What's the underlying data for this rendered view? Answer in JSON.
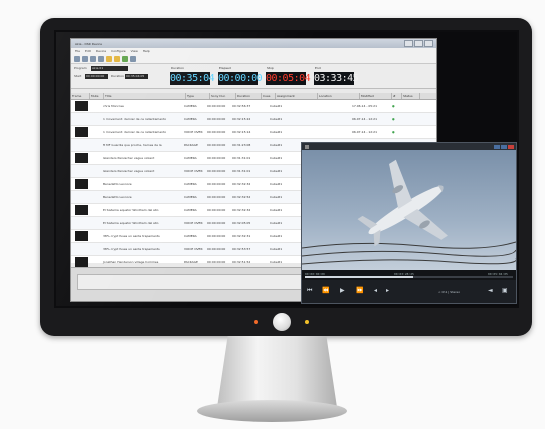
{
  "app": {
    "title": "Akia - DSR Device",
    "menu": [
      "File",
      "Edit",
      "Device",
      "Configure",
      "View",
      "Help"
    ],
    "labels": {
      "program": "Program",
      "start": "Start",
      "duration": "Duration",
      "elapsed": "Elapsed",
      "to_end": "Stop",
      "end": "End"
    },
    "fields": {
      "program_value": "Akia 01",
      "start_value": "00:00:00:00",
      "duration_value": "00:35:04:05"
    },
    "timers": {
      "duration": "00:35:04",
      "elapsed": "00:00:00",
      "remaining": "00:05:04",
      "end": "03:33:45"
    },
    "columns": [
      "Frame",
      "Mute",
      "Title",
      "Type",
      "Sony Dur.",
      "Duration",
      "Cues",
      "Assignment",
      "Location",
      "Modified",
      "#",
      "Status"
    ],
    "rows": [
      {
        "title": "chris Monrose",
        "type": "CAMERA",
        "dur": "00:00:00:00",
        "dur2": "00:32:56:37",
        "assign": "Cube#1",
        "mod": "17.06.14 - 05:21"
      },
      {
        "title": "1 movement: dernier de ce rallentamento",
        "type": "CAMERA",
        "dur": "00:00:00:00",
        "dur2": "00:32:15:22",
        "assign": "Cube#1",
        "mod": "06.07.14 - 12:21"
      },
      {
        "title": "1 movement: dernier de ce rallentamento",
        "type": "VOICE OVER",
        "dur": "00:00:00:00",
        "dur2": "00:32:15:14",
        "assign": "Cube#1",
        "mod": "06.07.14 - 12:21"
      },
      {
        "title": "ft MF Guardia que proche, harnes de la",
        "type": "PACKAGE",
        "dur": "00:00:00:00",
        "dur2": "00:31:23:08",
        "assign": "Cube#1",
        "mod": "06.07.14 - 12:24"
      },
      {
        "title": "Islanders Persischer vague violent",
        "type": "CAMERA",
        "dur": "00:00:00:00",
        "dur2": "00:31:31:01",
        "assign": "Cube#1",
        "mod": ""
      },
      {
        "title": "Islanders Persischer vague violent",
        "type": "VOICE OVER",
        "dur": "00:00:00:00",
        "dur2": "00:31:31:01",
        "assign": "Cube#1",
        "mod": ""
      },
      {
        "title": "Benedetto Leonore",
        "type": "CAMERA",
        "dur": "00:00:00:00",
        "dur2": "00:32:32:32",
        "assign": "Cube#1",
        "mod": ""
      },
      {
        "title": "Benedetto Leonore",
        "type": "CAMERA",
        "dur": "00:00:00:00",
        "dur2": "00:32:32:52",
        "assign": "Cube#1",
        "mod": ""
      },
      {
        "title": "El Sistema equator Windham del sito",
        "type": "CAMERA",
        "dur": "00:00:00:00",
        "dur2": "00:32:32:32",
        "assign": "Cube#1",
        "mod": ""
      },
      {
        "title": "El Sistema equator Windham del sito",
        "type": "VOICE OVER",
        "dur": "00:00:00:00",
        "dur2": "00:32:05:05",
        "assign": "Cube#1",
        "mod": ""
      },
      {
        "title": "38% crypt fuses un sante trapements",
        "type": "CAMERA",
        "dur": "00:00:00:00",
        "dur2": "00:32:32:31",
        "assign": "Cube#1",
        "mod": ""
      },
      {
        "title": "38% crypt fuses un sante trapements",
        "type": "VOICE OVER",
        "dur": "00:00:00:00",
        "dur2": "00:32:53:57",
        "assign": "Cube#1",
        "mod": ""
      },
      {
        "title": "Jonathan Henderson village hommes",
        "type": "PACKAGE",
        "dur": "00:00:00:00",
        "dur2": "00:32:51:52",
        "assign": "Cube#1",
        "mod": ""
      },
      {
        "title": "Mitsuaki rasta a l'ouage",
        "type": "PACKAGE",
        "dur": "00:00:00:00",
        "dur2": "00:32:53:34",
        "assign": "Cube#1",
        "mod": ""
      }
    ]
  },
  "player": {
    "tc_start": "00:00:00:00",
    "tc_current": "00:03:28:25",
    "tc_end": "00:05:04:05",
    "progress": 0.52,
    "channel_label": "< Ch1 | Stereo",
    "icons": [
      "rewind-start-icon",
      "rewind-icon",
      "play-icon",
      "fast-forward-icon",
      "mark-in-icon",
      "mark-out-icon",
      "volume-icon",
      "fullscreen-icon"
    ]
  }
}
